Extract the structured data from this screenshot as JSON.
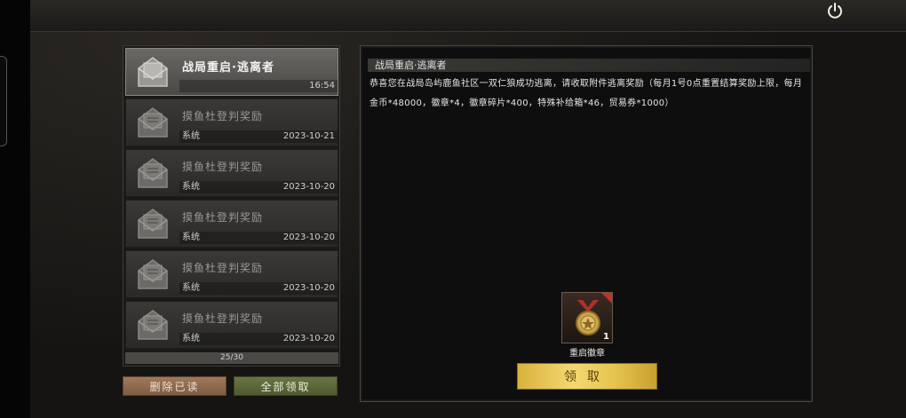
{
  "mail_list": {
    "items": [
      {
        "title": "战局重启·逃离者",
        "sender": "",
        "date": "16:54",
        "active": true
      },
      {
        "title": "摸鱼杜登判奖励",
        "sender": "系统",
        "date": "2023-10-21",
        "active": false
      },
      {
        "title": "摸鱼杜登判奖励",
        "sender": "系统",
        "date": "2023-10-20",
        "active": false
      },
      {
        "title": "摸鱼杜登判奖励",
        "sender": "系统",
        "date": "2023-10-20",
        "active": false
      },
      {
        "title": "摸鱼杜登判奖励",
        "sender": "系统",
        "date": "2023-10-20",
        "active": false
      },
      {
        "title": "摸鱼杜登判奖励",
        "sender": "系统",
        "date": "2023-10-20",
        "active": false
      }
    ],
    "count": "25/30"
  },
  "actions": {
    "delete_read": "删除已读",
    "collect_all": "全部领取"
  },
  "detail": {
    "title": "战局重启·逃离者",
    "body": "恭喜您在战局岛屿鹿鱼社区一双仁狼成功逃离，请收取附件逃离奖励（每月1号0点重置结算奖励上限，每月金币*48000，徽章*4，徽章碎片*400，特殊补给箱*46，贸易券*1000）",
    "reward": {
      "name": "重启徽章",
      "count": "1",
      "icon": "medal-icon"
    },
    "collect_label": "领取"
  },
  "colors": {
    "collect_button": "#e6c44e",
    "delete_button": "#8e6a4e",
    "collect_all_button": "#5d6838"
  }
}
